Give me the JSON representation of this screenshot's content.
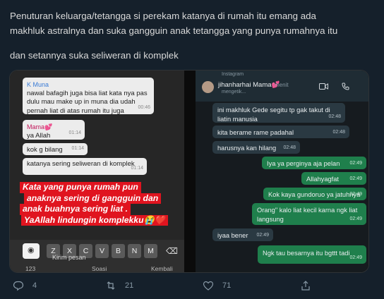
{
  "tweet": {
    "line1": "Penuturan keluarga/tetangga si perekam katanya di rumah itu emang ada",
    "line2": "makhluk astralnya dan suka gangguin anak tetangga yang punya rumahnya itu",
    "line3": "dan setannya suka seliweran di komplek"
  },
  "left_chat": {
    "messages": [
      {
        "sender": "K Muna",
        "text": "nawal bafagih juga bisa liat kata nya pas dulu mau make up in muna dia udah pernah liat di atas rumah itu juga",
        "time": "00:46"
      },
      {
        "sender": "Mama💕",
        "text": "ya Allah",
        "time": "01:14"
      },
      {
        "text": "kok g bilang",
        "time": "01:14"
      },
      {
        "text": "katanya sering seliweran di komplek",
        "time": "01:14"
      }
    ],
    "overlay_lines": [
      "Kata yang punya rumah pun",
      "anaknya sering di gangguin dan",
      "anak buahnya sering liat .",
      "YaAllah lindungin komplekku😭❤️"
    ],
    "keyboard": {
      "keys": [
        "Z",
        "X",
        "C",
        "V",
        "B",
        "N",
        "M"
      ],
      "num_label": "123",
      "send_label": "Kirim pesan",
      "suggest_label": "Soasi",
      "back_label": "Kembali"
    }
  },
  "right_chat": {
    "top_label": "Instagram",
    "contact": "jihanharhai Mama💕",
    "status": "mengetik...",
    "minutes": "menit",
    "messages": [
      {
        "dir": "in",
        "text": "ini makhluk Gede segitu tp gak takut di liatin manusia",
        "time": "02:48"
      },
      {
        "dir": "in",
        "text": "kita berame rame padahal",
        "time": "02:48"
      },
      {
        "dir": "in",
        "text": "harusnya kan hilang",
        "time": "02:48"
      },
      {
        "dir": "out",
        "text": "Iya ya perginya aja pelan",
        "time": "02:49"
      },
      {
        "dir": "out",
        "text": "Allahyagfat",
        "time": "02:49"
      },
      {
        "dir": "out",
        "text": "Kok kaya gundoruo ya jatuhnya",
        "time": "02:49"
      },
      {
        "dir": "out",
        "text": "Orang\" kalo liat kecil karna ngk liat langsung",
        "time": "02:49"
      },
      {
        "dir": "in",
        "text": "iyaa bener",
        "time": "02:49"
      },
      {
        "dir": "out",
        "text": "Ngk tau besarnya itu bgttt tadi",
        "time": "02:49"
      }
    ]
  },
  "actions": {
    "replies": "4",
    "retweets": "21",
    "likes": "71"
  }
}
